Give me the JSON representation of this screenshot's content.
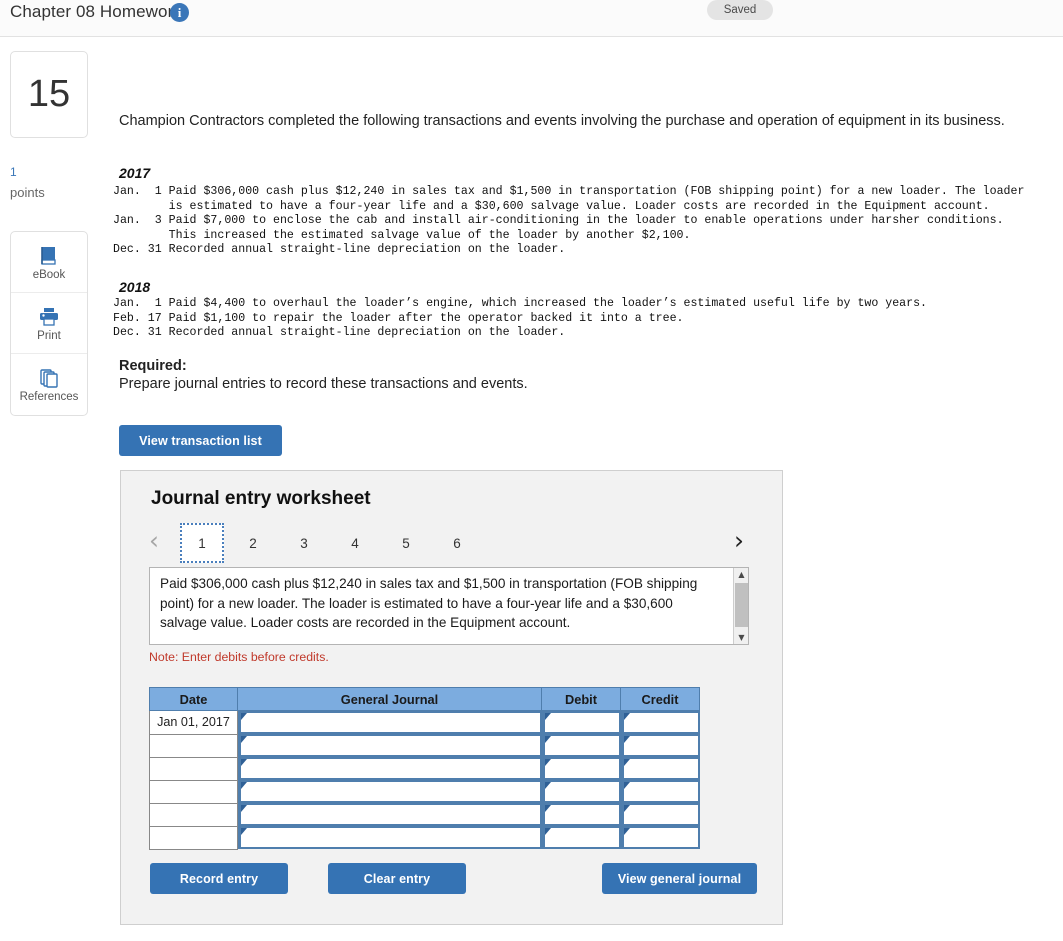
{
  "header": {
    "title": "Chapter 08 Homework",
    "info_icon": "info-icon",
    "status_badge": "Saved"
  },
  "sidebar": {
    "question_number": "15",
    "points_value": "1",
    "points_label": "points",
    "tools": [
      {
        "icon": "ebook-icon",
        "label": "eBook"
      },
      {
        "icon": "print-icon",
        "label": "Print"
      },
      {
        "icon": "references-icon",
        "label": "References"
      }
    ]
  },
  "problem": {
    "intro": "Champion Contractors completed the following transactions and events involving the purchase and operation of equipment in its business.",
    "year_2017_heading": "2017",
    "year_2017_lines": "Jan.  1 Paid $306,000 cash plus $12,240 in sales tax and $1,500 in transportation (FOB shipping point) for a new loader. The loader\n        is estimated to have a four-year life and a $30,600 salvage value. Loader costs are recorded in the Equipment account.\nJan.  3 Paid $7,000 to enclose the cab and install air-conditioning in the loader to enable operations under harsher conditions.\n        This increased the estimated salvage value of the loader by another $2,100.\nDec. 31 Recorded annual straight-line depreciation on the loader.",
    "year_2018_heading": "2018",
    "year_2018_lines": "Jan.  1 Paid $4,400 to overhaul the loader’s engine, which increased the loader’s estimated useful life by two years.\nFeb. 17 Paid $1,100 to repair the loader after the operator backed it into a tree.\nDec. 31 Recorded annual straight-line depreciation on the loader.",
    "required_heading": "Required:",
    "required_text": "Prepare journal entries to record these transactions and events.",
    "view_transaction_list_button": "View transaction list"
  },
  "worksheet": {
    "title": "Journal entry worksheet",
    "prev_arrow": "‹",
    "next_arrow": "›",
    "tabs": [
      "1",
      "2",
      "3",
      "4",
      "5",
      "6"
    ],
    "active_tab": "1",
    "description": "Paid $306,000 cash plus $12,240 in sales tax and $1,500 in transportation (FOB shipping point) for a new loader. The loader is estimated to have a four-year life and a $30,600 salvage value. Loader costs are recorded in the Equipment account.",
    "note": "Note: Enter debits before credits.",
    "table": {
      "columns": [
        "Date",
        "General Journal",
        "Debit",
        "Credit"
      ],
      "rows": [
        {
          "date": "Jan 01, 2017",
          "general_journal": "",
          "debit": "",
          "credit": ""
        },
        {
          "date": "",
          "general_journal": "",
          "debit": "",
          "credit": ""
        },
        {
          "date": "",
          "general_journal": "",
          "debit": "",
          "credit": ""
        },
        {
          "date": "",
          "general_journal": "",
          "debit": "",
          "credit": ""
        },
        {
          "date": "",
          "general_journal": "",
          "debit": "",
          "credit": ""
        },
        {
          "date": "",
          "general_journal": "",
          "debit": "",
          "credit": ""
        }
      ]
    },
    "record_entry_button": "Record entry",
    "clear_entry_button": "Clear entry",
    "view_general_journal_button": "View general journal"
  },
  "colors": {
    "accent_blue": "#3573b4",
    "table_header_blue": "#7cacdf",
    "cell_border_blue": "#4f7ead",
    "note_red": "#c0392b"
  }
}
